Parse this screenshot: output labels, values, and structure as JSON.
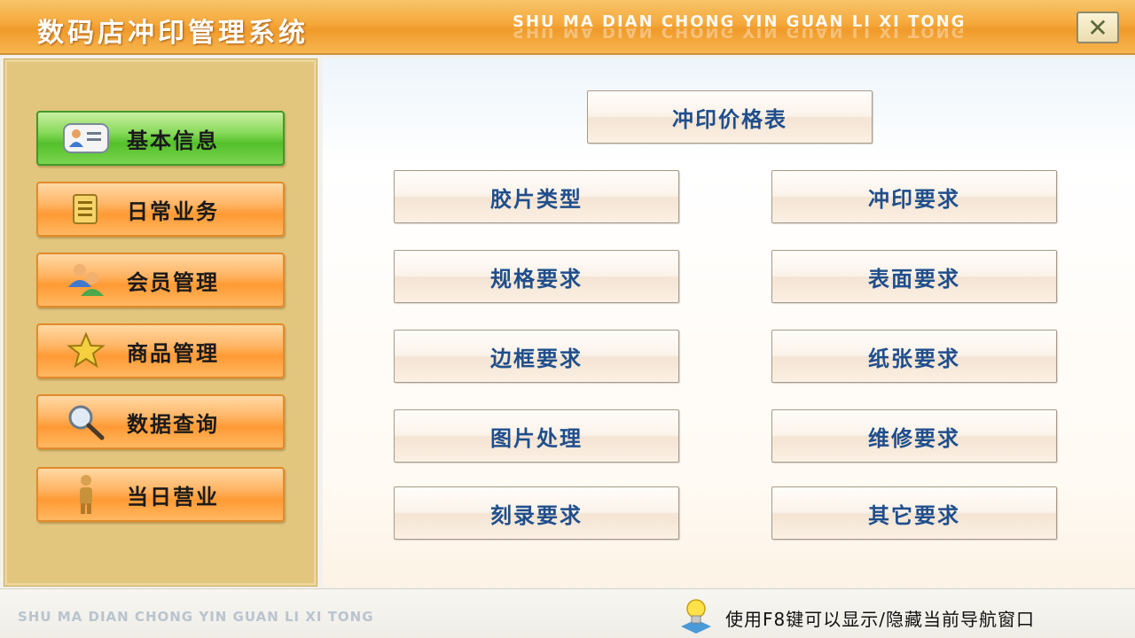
{
  "window": {
    "title": "数码店冲印管理系统",
    "pinyin_title": "SHU MA DIAN CHONG YIN GUAN LI XI TONG",
    "close_glyph": "✕"
  },
  "sidebar": {
    "items": [
      {
        "label": "基本信息",
        "icon": "contact-card-icon",
        "active": true
      },
      {
        "label": "日常业务",
        "icon": "notepad-icon",
        "active": false
      },
      {
        "label": "会员管理",
        "icon": "users-icon",
        "active": false
      },
      {
        "label": "商品管理",
        "icon": "star-icon",
        "active": false
      },
      {
        "label": "数据查询",
        "icon": "magnifier-icon",
        "active": false
      },
      {
        "label": "当日营业",
        "icon": "person-icon",
        "active": false
      }
    ]
  },
  "main": {
    "price_table_label": "冲印价格表",
    "buttons": [
      "胶片类型",
      "冲印要求",
      "规格要求",
      "表面要求",
      "边框要求",
      "纸张要求",
      "图片处理",
      "维修要求",
      "刻录要求",
      "其它要求"
    ]
  },
  "footer": {
    "pinyin": "SHU MA DIAN CHONG YIN GUAN LI XI TONG",
    "hint": "使用F8键可以显示/隐藏当前导航窗口"
  },
  "colors": {
    "title_bar": "#f5a83a",
    "sidebar_bg": "#e2c67e",
    "nav_orange": "#ff9a34",
    "nav_active_green": "#54c02a",
    "button_text_blue": "#1f4e8c"
  }
}
